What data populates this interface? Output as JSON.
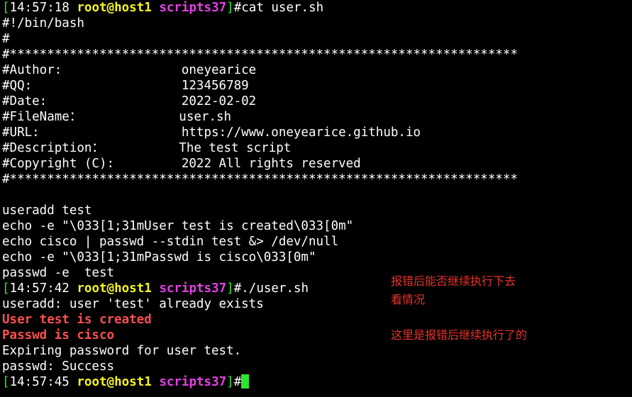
{
  "prompts": {
    "p1": {
      "time": "14:57:18",
      "user": "root",
      "host": "host1",
      "dir": "scripts37",
      "cmd": "cat user.sh"
    },
    "p2": {
      "time": "14:57:42",
      "user": "root",
      "host": "host1",
      "dir": "scripts37",
      "cmd": "./user.sh"
    },
    "p3": {
      "time": "14:57:45",
      "user": "root",
      "host": "host1",
      "dir": "scripts37",
      "cmd": ""
    }
  },
  "script_lines": [
    "#!/bin/bash",
    "#",
    "#********************************************************************",
    "#Author:                oneyearice",
    "#QQ:                    123456789",
    "#Date:                  2022-02-02",
    "#FileName：             user.sh",
    "#URL:                   https://www.oneyearice.github.io",
    "#Description：          The test script",
    "#Copyright (C):         2022 All rights reserved",
    "#********************************************************************",
    "",
    "useradd test",
    "echo -e \"\\033[1;31mUser test is created\\033[0m\"",
    "echo cisco | passwd --stdin test &> /dev/null",
    "echo -e \"\\033[1;31mPasswd is cisco\\033[0m\"",
    "passwd -e  test"
  ],
  "output_lines": {
    "useradd_msg": "useradd: user 'test' already exists",
    "created_msg": "User test is created",
    "passwd_msg": "Passwd is cisco",
    "expiring_msg": "Expiring password for user test.",
    "success_msg": "passwd: Success"
  },
  "annotations": {
    "note1_line1": "报错后能否继续执行下去",
    "note1_line2": "看情况",
    "note2": "这里是报错后继续执行了的"
  },
  "colors": {
    "background": "#000000",
    "bracket_green": "#2fe52f",
    "user_yellow": "#f5f51e",
    "dir_magenta": "#e53fe5",
    "error_red": "#ff4f4f",
    "annotation_red": "#e8312c"
  }
}
